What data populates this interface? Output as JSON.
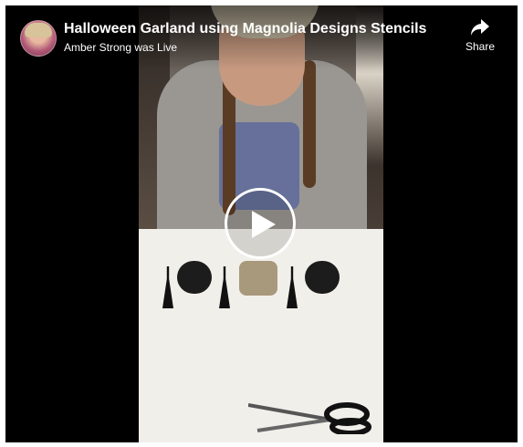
{
  "video": {
    "title": "Halloween Garland using Magnolia Designs Stencils",
    "subtitle": "Amber Strong was Live"
  },
  "controls": {
    "share_label": "Share",
    "play_icon": "play-icon",
    "share_icon": "share-arrow-icon"
  },
  "colors": {
    "background": "#000000",
    "text": "#ffffff"
  }
}
